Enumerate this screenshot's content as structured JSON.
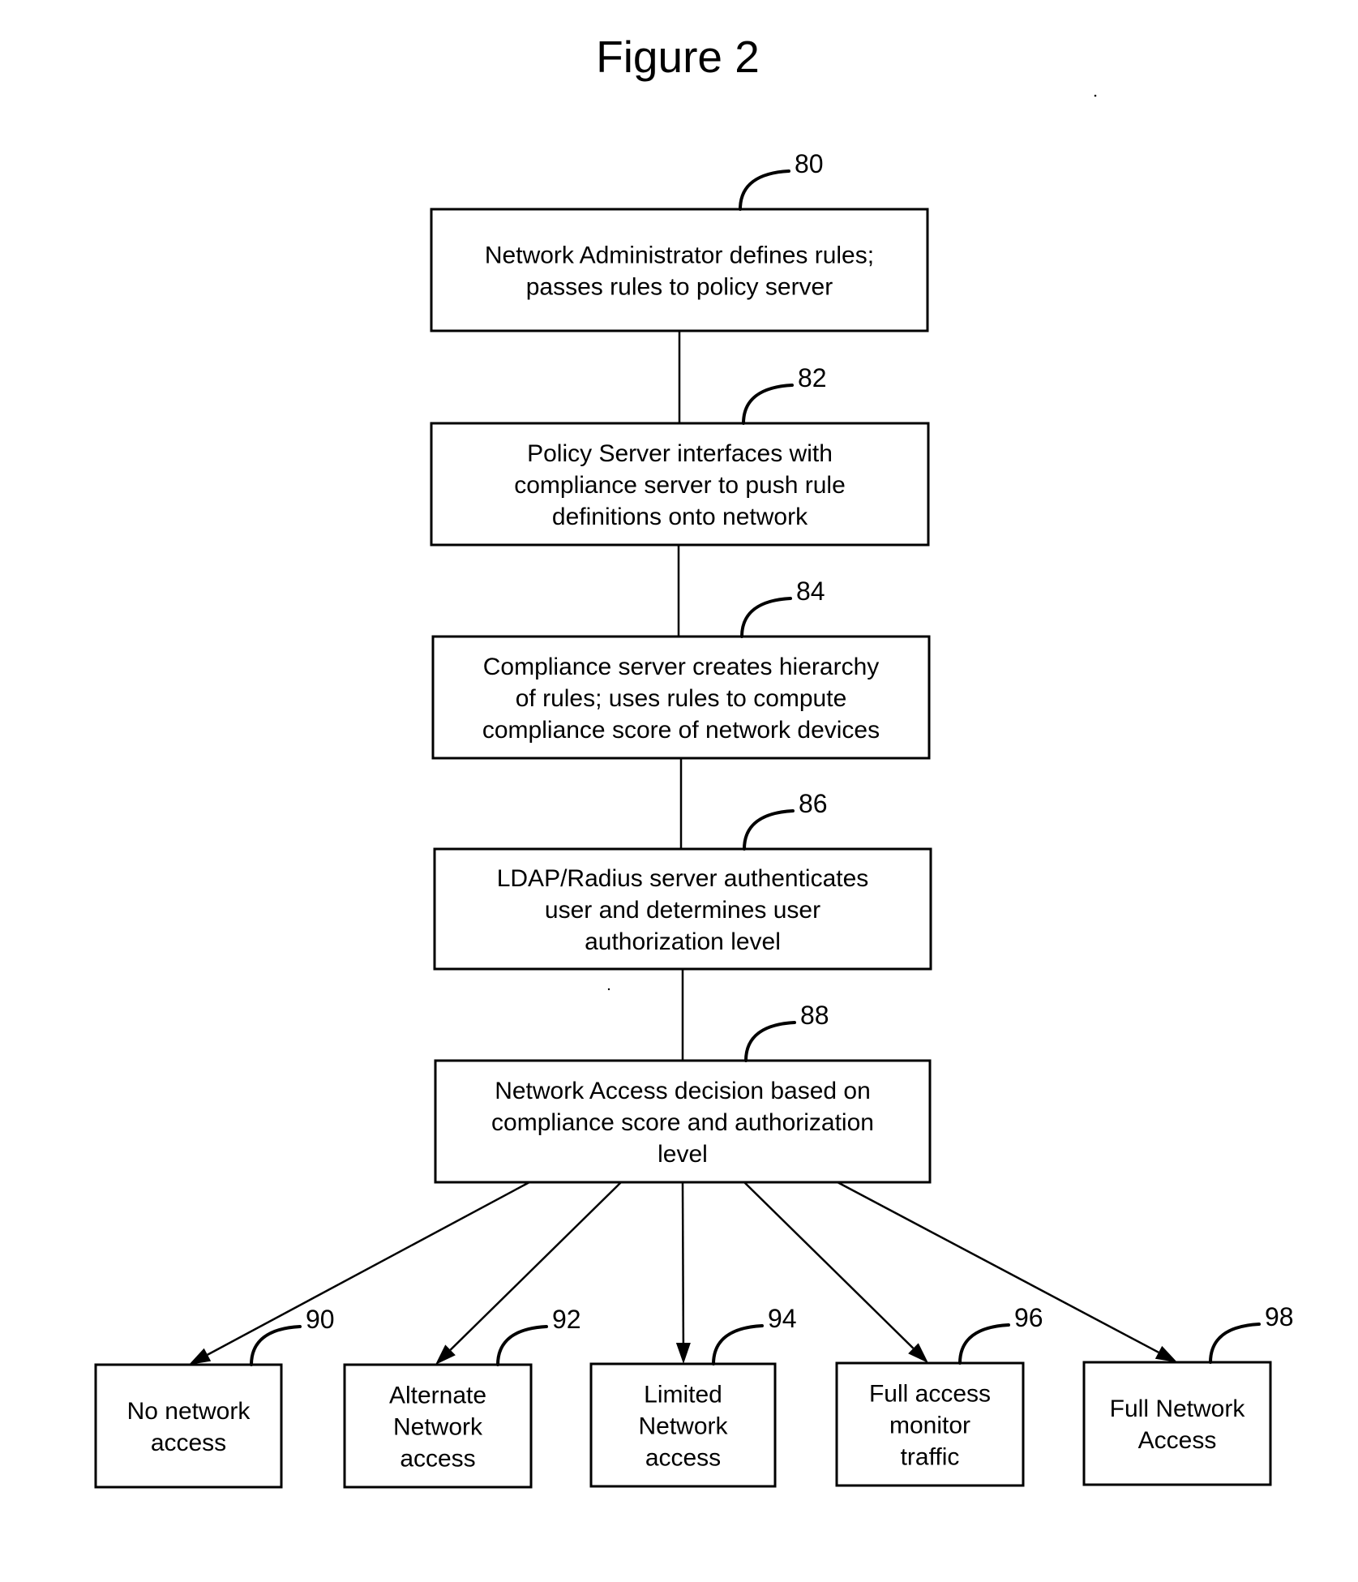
{
  "figure": {
    "title": "Figure 2"
  },
  "colors": {
    "ink": "#000000",
    "background": "#ffffff"
  },
  "steps": [
    {
      "ref": "80",
      "lines": [
        "Network Administrator defines rules;",
        "passes rules to policy server"
      ]
    },
    {
      "ref": "82",
      "lines": [
        "Policy Server interfaces with",
        "compliance server to push rule",
        "definitions onto network"
      ]
    },
    {
      "ref": "84",
      "lines": [
        "Compliance server creates hierarchy",
        "of rules; uses rules to compute",
        "compliance score of network devices"
      ]
    },
    {
      "ref": "86",
      "lines": [
        "LDAP/Radius server authenticates",
        "user and determines user",
        "authorization level"
      ]
    },
    {
      "ref": "88",
      "lines": [
        "Network Access decision based on",
        "compliance score and authorization",
        "level"
      ]
    }
  ],
  "outcomes": [
    {
      "ref": "90",
      "lines": [
        "No network",
        "access"
      ]
    },
    {
      "ref": "92",
      "lines": [
        "Alternate",
        "Network",
        "access"
      ]
    },
    {
      "ref": "94",
      "lines": [
        "Limited",
        "Network",
        "access"
      ]
    },
    {
      "ref": "96",
      "lines": [
        "Full access",
        "monitor",
        "traffic"
      ]
    },
    {
      "ref": "98",
      "lines": [
        "Full Network",
        "Access"
      ]
    }
  ]
}
